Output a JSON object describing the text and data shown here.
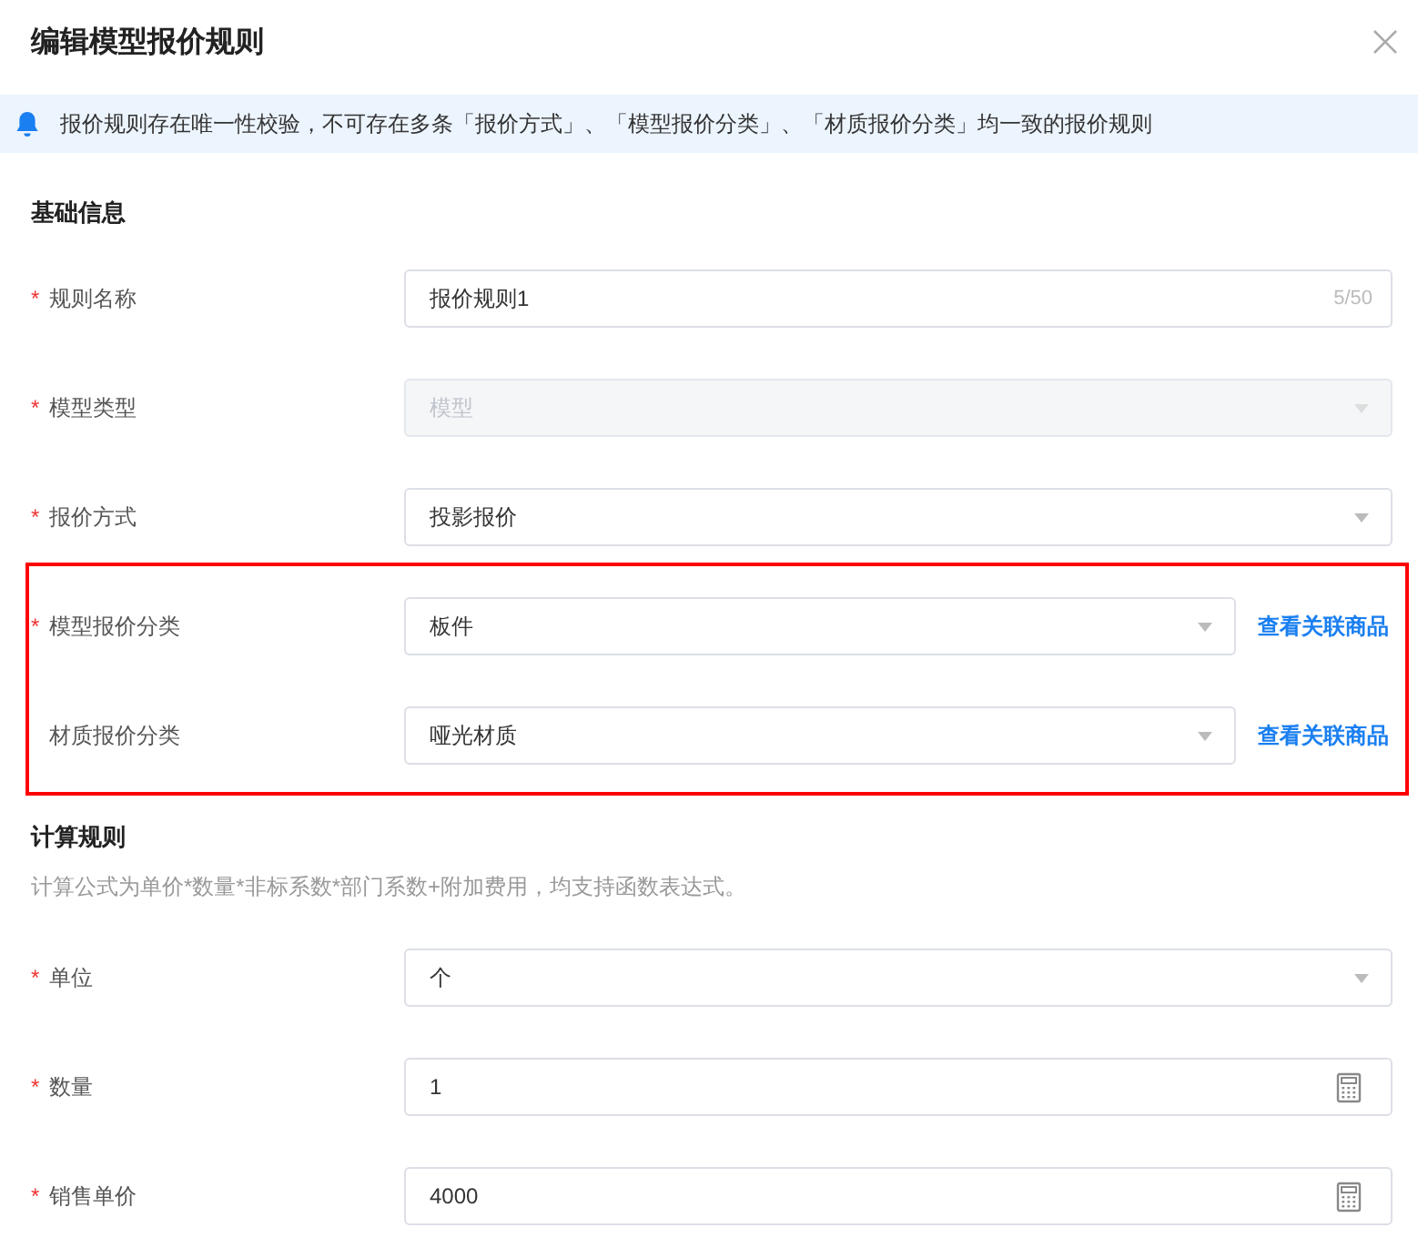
{
  "dialog": {
    "title": "编辑模型报价规则"
  },
  "alert": {
    "text": "报价规则存在唯一性校验，不可存在多条「报价方式」、「模型报价分类」、「材质报价分类」均一致的报价规则"
  },
  "sections": [
    {
      "title": "基础信息",
      "rows": [
        {
          "label": "规则名称",
          "required_mark": "*",
          "kind": "text",
          "value": "报价规则1",
          "counter": "5/50",
          "disabled": false,
          "highlighted": false
        },
        {
          "label": "模型类型",
          "required_mark": "*",
          "kind": "select",
          "value": "模型",
          "disabled": true,
          "highlighted": false
        },
        {
          "label": "报价方式",
          "required_mark": "*",
          "kind": "select",
          "value": "投影报价",
          "disabled": false,
          "highlighted": false
        },
        {
          "label": "模型报价分类",
          "required_mark": "*",
          "kind": "select",
          "value": "板件",
          "disabled": false,
          "highlighted": true,
          "link": "查看关联商品"
        },
        {
          "label": "材质报价分类",
          "kind": "select",
          "value": "哑光材质",
          "disabled": false,
          "highlighted": true,
          "link": "查看关联商品"
        }
      ]
    },
    {
      "title": "计算规则",
      "note": "计算公式为单价*数量*非标系数*部门系数+附加费用，均支持函数表达式。",
      "rows": [
        {
          "label": "单位",
          "required_mark": "*",
          "kind": "select",
          "value": "个",
          "disabled": false,
          "highlighted": false
        },
        {
          "label": "数量",
          "required_mark": "*",
          "kind": "number",
          "value": "1",
          "disabled": false,
          "highlighted": false
        },
        {
          "label": "销售单价",
          "required_mark": "*",
          "kind": "number",
          "value": "4000",
          "disabled": false,
          "highlighted": false
        }
      ]
    }
  ]
}
